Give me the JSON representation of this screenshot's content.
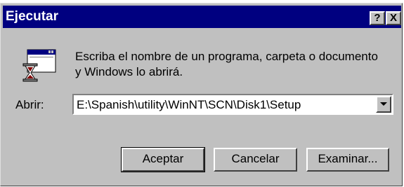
{
  "window": {
    "title": "Ejecutar",
    "help_button": "?",
    "close_button": "X"
  },
  "prompt": {
    "line1": "Escriba el nombre de un programa, carpeta o documento",
    "line2": "y Windows lo abrirá."
  },
  "open_field": {
    "label": "Abrir:",
    "value": "E:\\Spanish\\utility\\WinNT\\SCN\\Disk1\\Setup"
  },
  "buttons": {
    "accept": "Aceptar",
    "cancel": "Cancelar",
    "browse": "Examinar..."
  },
  "icons": {
    "run": "run-program-icon",
    "dropdown": "chevron-down-icon"
  }
}
